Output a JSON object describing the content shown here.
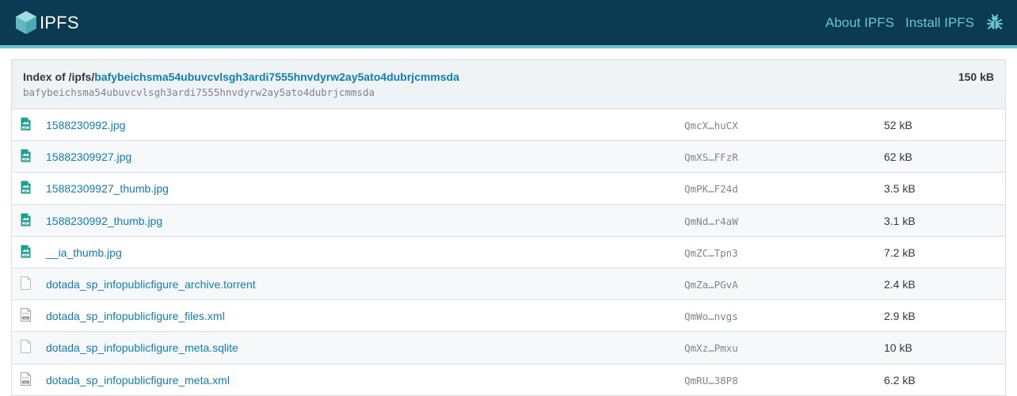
{
  "header": {
    "logo_text": "IPFS",
    "nav": [
      {
        "label": "About IPFS"
      },
      {
        "label": "Install IPFS"
      }
    ],
    "bug_icon": "bug-icon"
  },
  "listing": {
    "title_prefix": "Index of /ipfs/",
    "cid": "bafybeichsma54ubuvcvlsgh3ardi7555hnvdyrw2ay5ato4dubrjcmmsda",
    "cid_sub": "bafybeichsma54ubuvcvlsgh3ardi7555hnvdyrw2ay5ato4dubrjcmmsda",
    "total_size": "150 kB"
  },
  "files": [
    {
      "name": "1588230992.jpg",
      "hash": "QmcX…huCX",
      "size": "52 kB",
      "icon": "jpg-file-icon"
    },
    {
      "name": "15882309927.jpg",
      "hash": "QmXS…FFzR",
      "size": "62 kB",
      "icon": "jpg-file-icon"
    },
    {
      "name": "15882309927_thumb.jpg",
      "hash": "QmPK…F24d",
      "size": "3.5 kB",
      "icon": "jpg-file-icon"
    },
    {
      "name": "1588230992_thumb.jpg",
      "hash": "QmNd…r4aW",
      "size": "3.1 kB",
      "icon": "jpg-file-icon"
    },
    {
      "name": "__ia_thumb.jpg",
      "hash": "QmZC…Tpn3",
      "size": "7.2 kB",
      "icon": "jpg-file-icon"
    },
    {
      "name": "dotada_sp_infopublicfigure_archive.torrent",
      "hash": "QmZa…PGvA",
      "size": "2.4 kB",
      "icon": "generic-file-icon"
    },
    {
      "name": "dotada_sp_infopublicfigure_files.xml",
      "hash": "QmWo…nvgs",
      "size": "2.9 kB",
      "icon": "xml-file-icon"
    },
    {
      "name": "dotada_sp_infopublicfigure_meta.sqlite",
      "hash": "QmXz…Pmxu",
      "size": "10 kB",
      "icon": "generic-file-icon"
    },
    {
      "name": "dotada_sp_infopublicfigure_meta.xml",
      "hash": "QmRU…38P8",
      "size": "6.2 kB",
      "icon": "xml-file-icon"
    }
  ],
  "colors": {
    "topbar": "#0b3a53",
    "accent": "#69c4cd",
    "link": "#117eb3",
    "header_bg": "#f0f3f6",
    "jpg_icon": "#1a9d8a"
  }
}
